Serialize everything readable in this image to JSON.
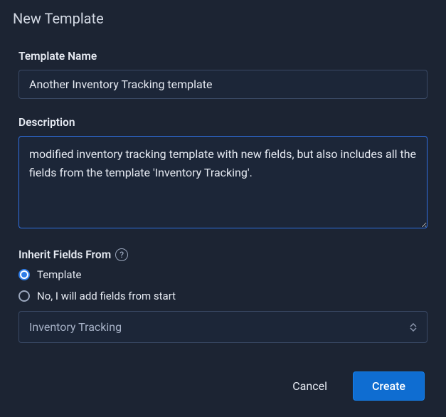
{
  "dialog": {
    "title": "New Template"
  },
  "form": {
    "name_label": "Template Name",
    "name_value": "Another Inventory Tracking template",
    "description_label": "Description",
    "description_value": "modified inventory tracking template with new fields, but also includes all the fields from the template 'Inventory Tracking'.",
    "inherit_label": "Inherit Fields From",
    "inherit_options": {
      "template": "Template",
      "none": "No, I will add fields from start"
    },
    "inherit_selected": "template",
    "select_value": "Inventory Tracking"
  },
  "footer": {
    "cancel": "Cancel",
    "create": "Create"
  }
}
